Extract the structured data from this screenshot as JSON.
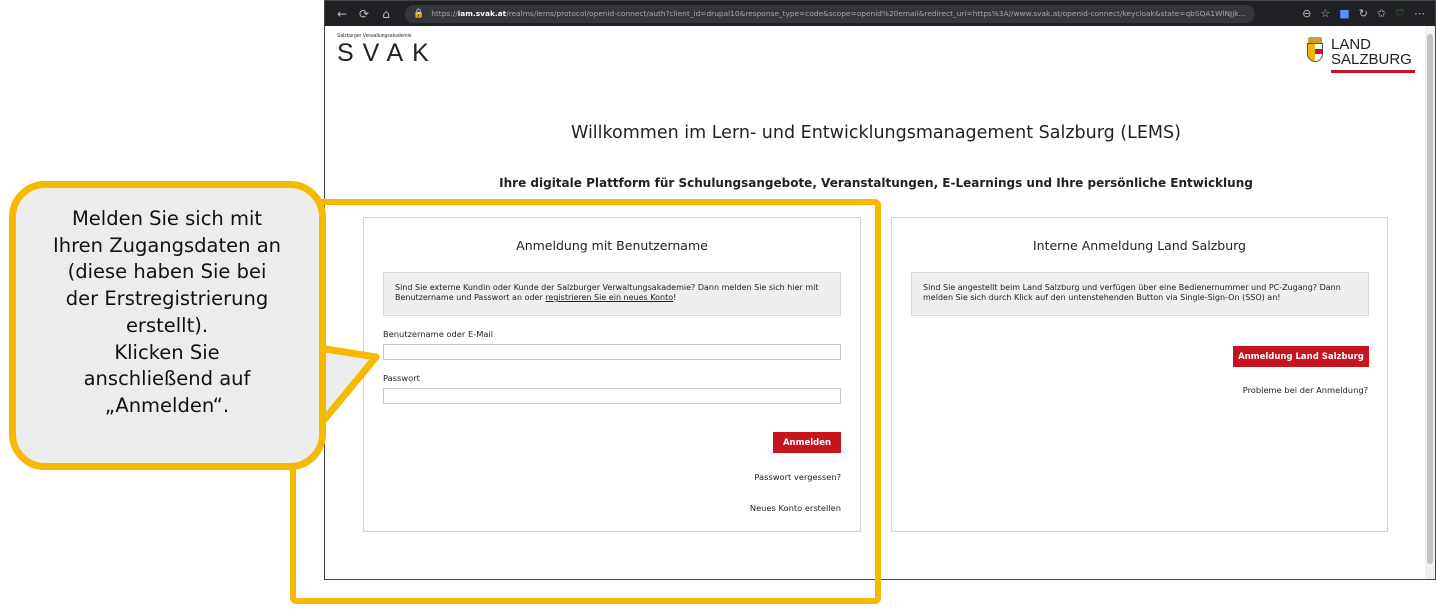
{
  "browser": {
    "url_host": "iam.svak.at",
    "url_rest": "/realms/lems/protocol/openid-connect/auth?client_id=drupal10&response_type=code&scope=openid%20email&redirect_uri=https%3A//www.svak.at/openid-connect/keycloak&state=qbSQA1WlNJjkj_35X...",
    "url_prefix": "https://",
    "icons": {
      "back": "back-arrow-icon",
      "reload": "reload-icon",
      "home": "home-icon",
      "lock": "lock-icon"
    }
  },
  "header": {
    "svak_subtitle": "Salzburger Verwaltungsakademie",
    "svak_logo_text": "SVAK",
    "land_logo_line1": "LAND",
    "land_logo_line2": "SALZBURG"
  },
  "main": {
    "headline": "Willkommen im Lern- und Entwicklungsmanagement Salzburg (LEMS)",
    "subheadline": "Ihre digitale Plattform für Schulungsangebote, Veranstaltungen, E-Learnings und Ihre persönliche Entwicklung"
  },
  "left_panel": {
    "title": "Anmeldung mit Benutzername",
    "info_text": "Sind Sie externe Kundin oder Kunde der Salzburger Verwaltungsakademie? Dann melden Sie sich hier mit Benutzername und Passwort an oder ",
    "info_link": "registrieren Sie ein neues Konto",
    "info_end": "!",
    "username_label": "Benutzername oder E-Mail",
    "username_value": "",
    "password_label": "Passwort",
    "password_value": "",
    "login_button": "Anmelden",
    "forgot_password": "Passwort vergessen?",
    "new_account": "Neues Konto erstellen"
  },
  "right_panel": {
    "title": "Interne Anmeldung Land Salzburg",
    "info_text": "Sind Sie angestellt beim Land Salzburg und verfügen über eine Bedienernummer und PC-Zugang? Dann melden Sie sich durch Klick auf den untenstehenden Button via Single-Sign-On (SSO) an!",
    "sso_button": "Anmeldung Land Salzburg",
    "problems_link": "Probleme bei der Anmeldung?"
  },
  "callout": {
    "lines": [
      "Melden Sie sich mit",
      "Ihren Zugangsdaten an",
      "(diese haben Sie bei",
      "der Erstregistrierung",
      "erstellt).",
      "Klicken Sie",
      "anschließend auf",
      "„Anmelden“."
    ],
    "accent_color": "#F5B900"
  },
  "colors": {
    "brand_red": "#C8141E",
    "callout_yellow": "#F5B900"
  }
}
